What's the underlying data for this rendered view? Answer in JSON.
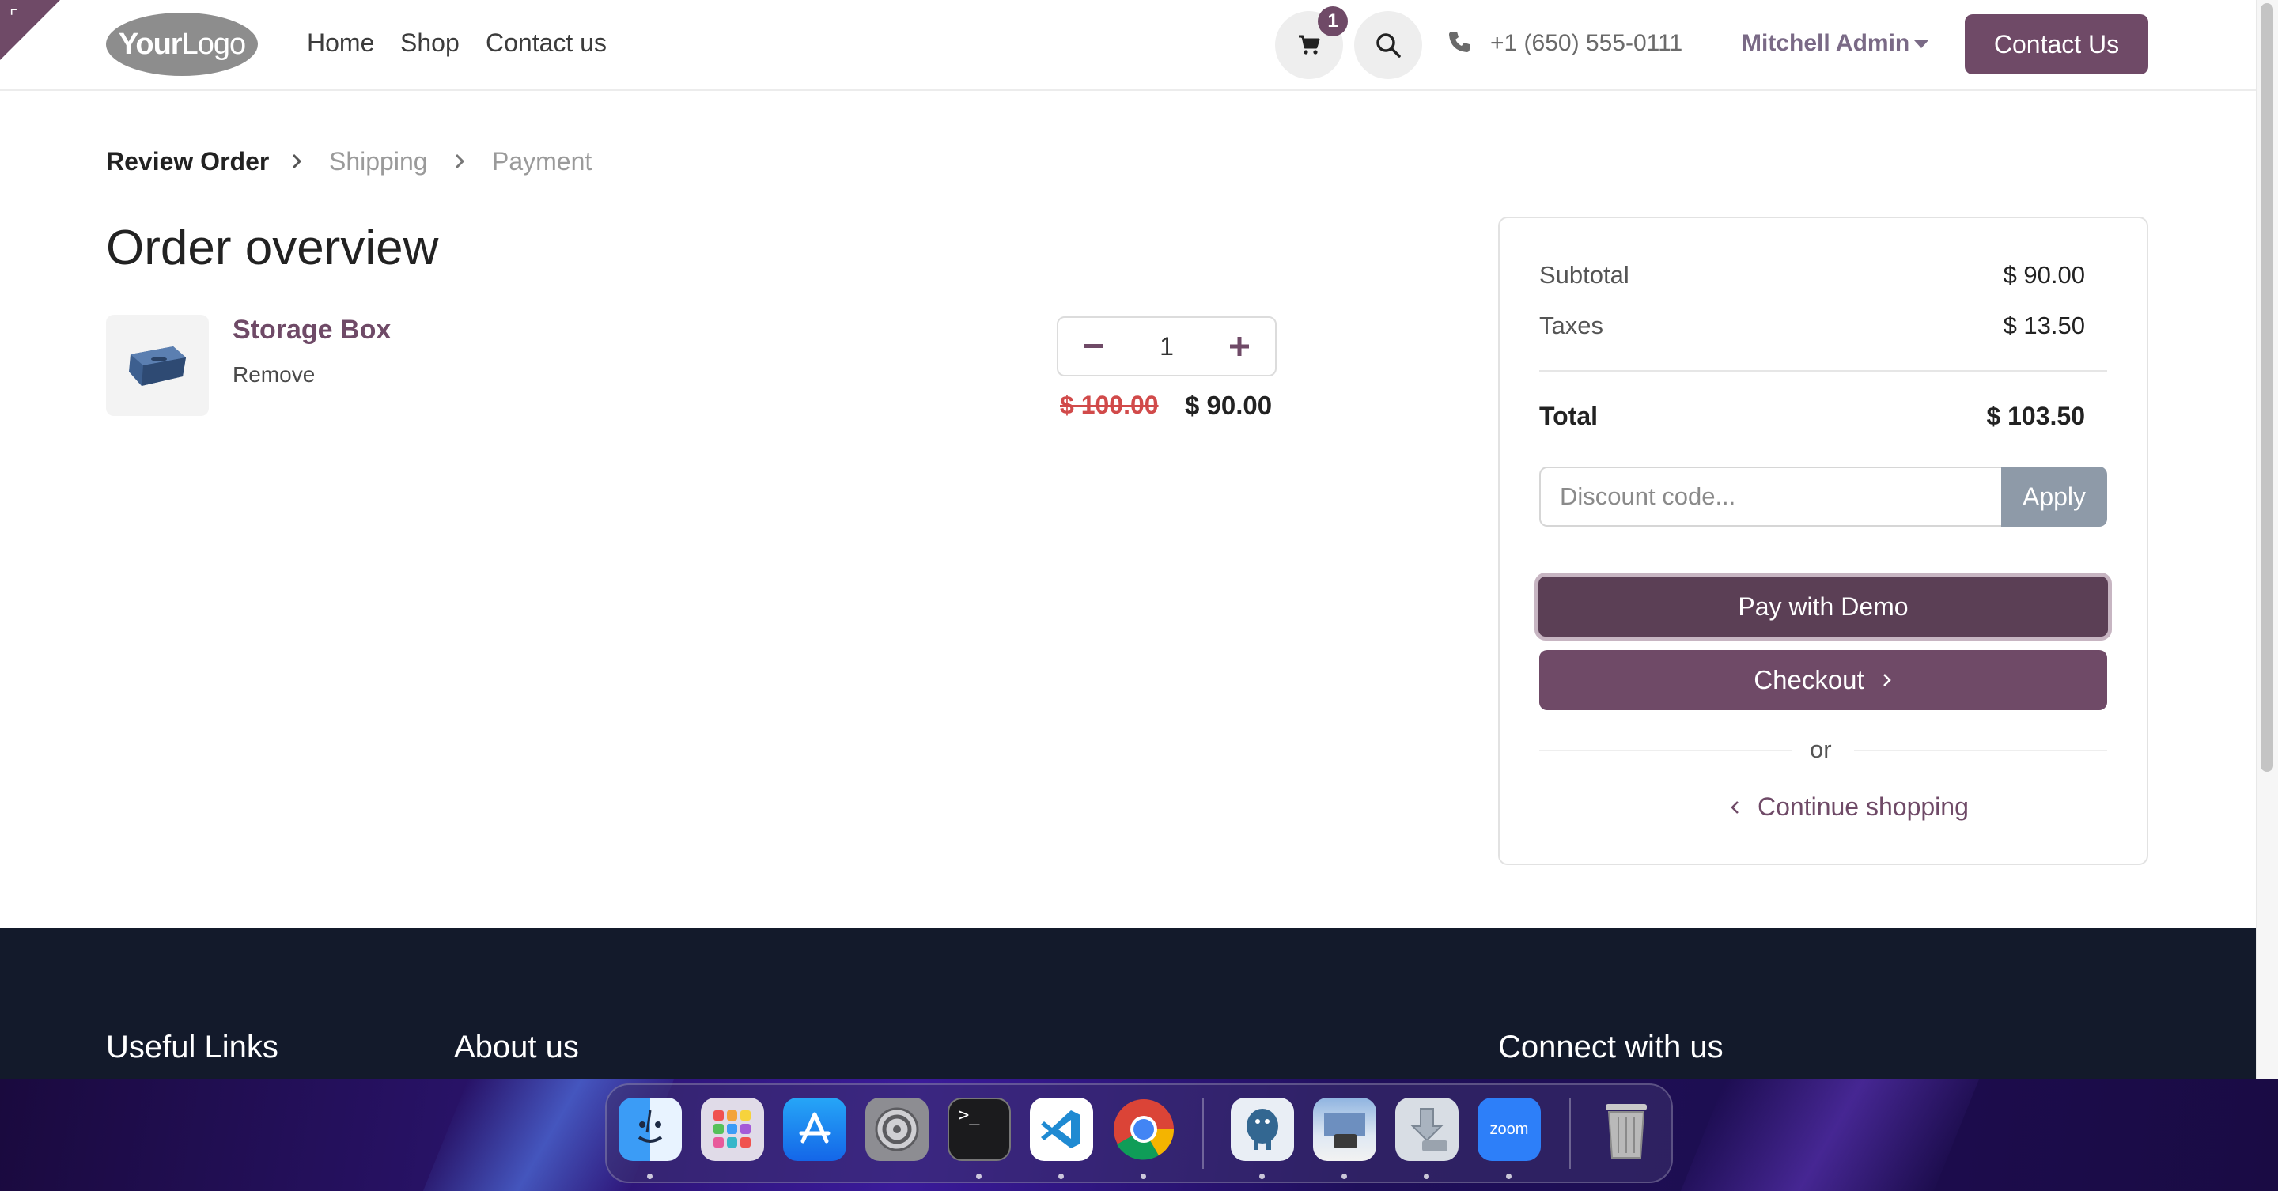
{
  "header": {
    "logo_text_bold": "Your",
    "logo_text_light": "Logo",
    "nav": [
      "Home",
      "Shop",
      "Contact us"
    ],
    "cart_count": "1",
    "phone": "+1 (650) 555-0111",
    "user": "Mitchell Admin",
    "contact_button": "Contact Us"
  },
  "breadcrumb": {
    "steps": [
      "Review Order",
      "Shipping",
      "Payment"
    ]
  },
  "main": {
    "title": "Order overview",
    "product": {
      "name": "Storage Box",
      "remove_label": "Remove",
      "quantity": "1",
      "price_old": "$ 100.00",
      "price_new": "$ 90.00"
    }
  },
  "summary": {
    "subtotal_label": "Subtotal",
    "subtotal_value": "$ 90.00",
    "taxes_label": "Taxes",
    "taxes_value": "$ 13.50",
    "total_label": "Total",
    "total_value": "$ 103.50",
    "discount_placeholder": "Discount code...",
    "apply_label": "Apply",
    "pay_label": "Pay with Demo",
    "checkout_label": "Checkout",
    "or_label": "or",
    "continue_label": "Continue shopping"
  },
  "footer": {
    "headings": [
      "Useful Links",
      "About us",
      "Connect with us"
    ]
  },
  "dock": {
    "apps": [
      "finder-icon",
      "launchpad-icon",
      "app-store-icon",
      "system-settings-icon",
      "terminal-icon",
      "vscode-icon",
      "chrome-icon",
      "postgres-icon",
      "preview-icon",
      "downloads-icon",
      "zoom-icon",
      "trash-icon"
    ],
    "zoom_label": "zoom"
  },
  "colors": {
    "brand": "#6f4a67",
    "footer_bg": "#131a2b",
    "price_old": "#d14a4a"
  }
}
